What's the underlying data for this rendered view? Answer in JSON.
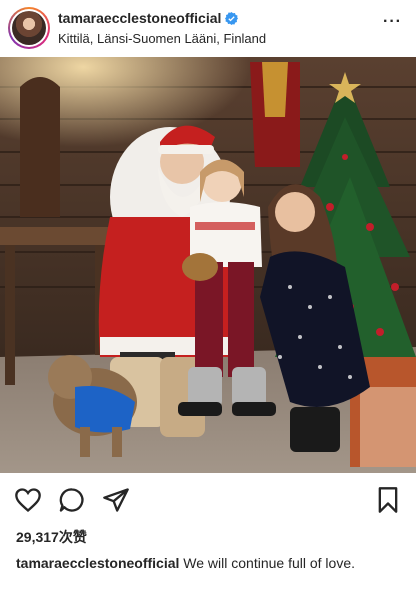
{
  "post": {
    "username": "tamaraecclestoneofficial",
    "verified_icon": "verified-badge-icon",
    "location": "Kittilä, Länsi-Suomen Lääni, Finland",
    "more_icon": "more-options-icon",
    "more_glyph": "···",
    "likes": "29,317次赞",
    "caption_user": "tamaraecclestoneofficial",
    "caption_text": "We will continue full of love."
  },
  "actions": {
    "like_icon": "heart-icon",
    "comment_icon": "comment-icon",
    "share_icon": "share-icon",
    "save_icon": "bookmark-icon"
  },
  "colors": {
    "verified_blue": "#3897f0",
    "text": "#262626"
  }
}
